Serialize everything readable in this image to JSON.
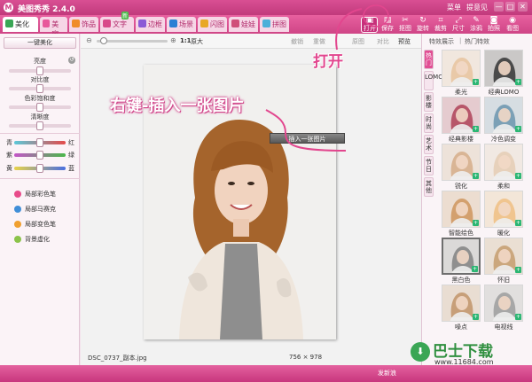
{
  "app": {
    "title": "美图秀秀 2.4.0",
    "menus": [
      "菜单",
      "提意见"
    ],
    "window_controls": [
      "—",
      "□",
      "✕"
    ]
  },
  "main_tabs": [
    {
      "label": "美化",
      "color": "#3aa655",
      "active": true
    },
    {
      "label": "美容",
      "color": "#e8589b"
    },
    {
      "label": "饰品",
      "color": "#f08c2a"
    },
    {
      "label": "文字",
      "color": "#d84a8a",
      "badge": "新"
    },
    {
      "label": "边框",
      "color": "#8b5ad6"
    },
    {
      "label": "场景",
      "color": "#2a7fd4"
    },
    {
      "label": "闪图",
      "color": "#e8a825"
    },
    {
      "label": "娃娃",
      "color": "#d04f7a"
    },
    {
      "label": "拼图",
      "color": "#4cb0d9"
    }
  ],
  "tools": [
    {
      "label": "打开",
      "icon": "folder-icon"
    },
    {
      "label": "保存",
      "icon": "save-icon"
    },
    {
      "label": "抠图",
      "icon": "scissors-icon"
    },
    {
      "label": "旋转",
      "icon": "rotate-icon"
    },
    {
      "label": "裁剪",
      "icon": "crop-icon"
    },
    {
      "label": "尺寸",
      "icon": "resize-icon"
    },
    {
      "label": "涂鸦",
      "icon": "brush-icon"
    },
    {
      "label": "拍照",
      "icon": "camera-icon"
    },
    {
      "label": "看图",
      "icon": "eye-icon"
    }
  ],
  "left_panel": {
    "auto_button": "一键美化",
    "adjustments": [
      {
        "label": "亮度",
        "value": 0.5
      },
      {
        "label": "对比度",
        "value": 0.5
      },
      {
        "label": "色彩饱和度",
        "value": 0.5
      },
      {
        "label": "清晰度",
        "value": 0.5
      }
    ],
    "color_balance": [
      {
        "left": "青",
        "right": "红",
        "value": 0.5
      },
      {
        "left": "紫",
        "right": "绿",
        "value": 0.5
      },
      {
        "left": "黄",
        "right": "蓝",
        "value": 0.5
      }
    ],
    "tools": [
      {
        "label": "局部彩色笔",
        "color": "#e84b8a"
      },
      {
        "label": "局部马赛克",
        "color": "#3f8ed8"
      },
      {
        "label": "局部变色笔",
        "color": "#f0a030"
      },
      {
        "label": "背景虚化",
        "color": "#8bc34a"
      }
    ]
  },
  "canvas": {
    "zoom_label": "1:1",
    "original_label": "原大",
    "actions": [
      "撤销",
      "重做",
      "原图",
      "对比",
      "预览"
    ],
    "filename": "DSC_0737_副本.jpg",
    "dimensions": "756 × 978",
    "context_menu_item": "插入一张图片"
  },
  "annotations": {
    "open": "打开",
    "insert": "右键-插入一张图片"
  },
  "right_panel": {
    "tabs": [
      "特效展示",
      "热门特效"
    ],
    "vertical_tabs": [
      "热门",
      "LOMO",
      "影楼",
      "时尚",
      "艺术",
      "节日",
      "其他"
    ],
    "effects": [
      {
        "label": "柔光",
        "tone": "#e9c9a8"
      },
      {
        "label": "经典LOMO",
        "tone": "#4a4a4a"
      },
      {
        "label": "经典影楼",
        "tone": "#b7566a"
      },
      {
        "label": "冷色调变",
        "tone": "#7ba0b6"
      },
      {
        "label": "锐化",
        "tone": "#d9b595"
      },
      {
        "label": "柔和",
        "tone": "#e7d1bb"
      },
      {
        "label": "智能绘色",
        "tone": "#d3a06e"
      },
      {
        "label": "暖化",
        "tone": "#f0c58f"
      },
      {
        "label": "黑白色",
        "tone": "#8f8f8f"
      },
      {
        "label": "怀旧",
        "tone": "#cba77d"
      },
      {
        "label": "噪点",
        "tone": "#c79f79"
      },
      {
        "label": "电视线",
        "tone": "#a7a7a7"
      }
    ]
  },
  "status": {
    "share": "发新浪"
  },
  "watermark": {
    "name": "巴士下载",
    "url": "www.11684.com"
  }
}
